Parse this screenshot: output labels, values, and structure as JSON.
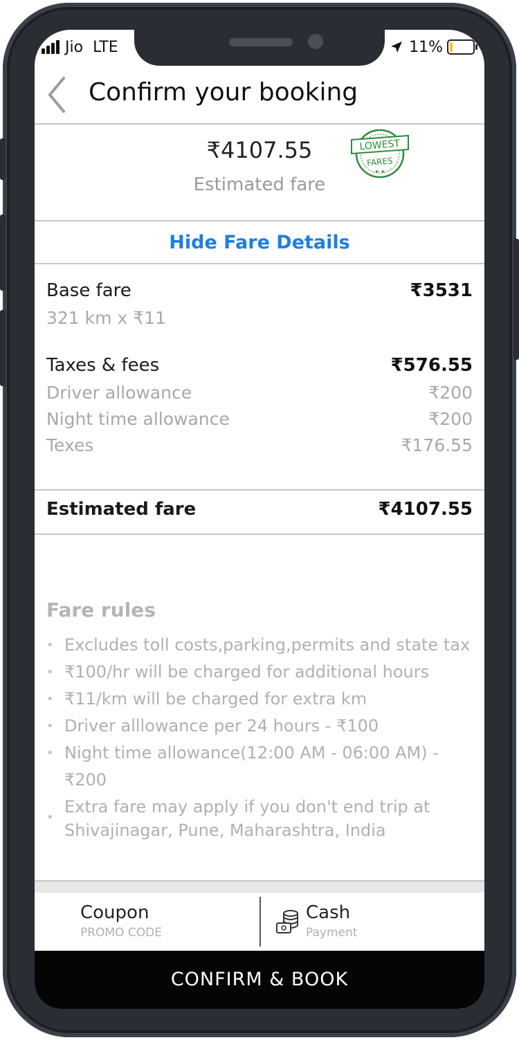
{
  "status_bar": {
    "carrier": "Jio",
    "network": "LTE",
    "battery": "11%"
  },
  "header": {
    "title": "Confirm your booking"
  },
  "fare_summary": {
    "amount": "₹4107.55",
    "label": "Estimated fare",
    "badge_line1": "LOWEST",
    "badge_line2": "FARES"
  },
  "toggle_details": "Hide Fare Details",
  "breakdown": {
    "base_label": "Base fare",
    "base_amount": "₹3531",
    "base_detail": "321 km x ₹11",
    "taxes_label": "Taxes & fees",
    "taxes_amount": "₹576.55",
    "items": [
      {
        "label": "Driver allowance",
        "amount": "₹200"
      },
      {
        "label": "Night time allowance",
        "amount": "₹200"
      },
      {
        "label": "Texes",
        "amount": "₹176.55"
      }
    ]
  },
  "total": {
    "label": "Estimated fare",
    "amount": "₹4107.55"
  },
  "fare_rules": {
    "title": "Fare rules",
    "items": [
      "Excludes toll costs,parking,permits and state tax",
      "₹100/hr will be charged for additional hours",
      "₹11/km will be charged for extra km",
      "Driver alllowance per 24 hours - ₹100",
      "Night time allowance(12:00 AM - 06:00 AM) -  ₹200",
      "Extra fare may apply if you don't end trip at Shivajinagar, Pune, Maharashtra, India"
    ]
  },
  "payment": {
    "coupon_title": "Coupon",
    "coupon_sub": "PROMO CODE",
    "cash_title": "Cash",
    "cash_sub": "Payment"
  },
  "confirm_button": "CONFIRM & BOOK",
  "colors": {
    "link": "#1e7fe0",
    "button_bg": "#050505",
    "badge": "#2e8b3a",
    "battery": "#f5c518"
  },
  "icons": [
    "back-chevron-icon",
    "location-arrow-icon",
    "battery-icon",
    "signal-icon",
    "cash-coins-icon"
  ]
}
